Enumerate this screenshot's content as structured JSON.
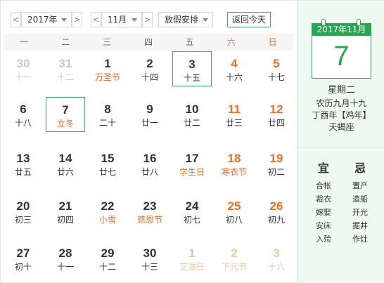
{
  "toolbar": {
    "prev_year": "<",
    "next_year": ">",
    "year": "2017年",
    "prev_month": "<",
    "next_month": ">",
    "month": "11月",
    "holiday": "放假安排",
    "today": "返回今天"
  },
  "weekdays": [
    "一",
    "二",
    "三",
    "四",
    "五",
    "六",
    "日"
  ],
  "rows": [
    [
      {
        "d": "30",
        "l": "十一",
        "other": true
      },
      {
        "d": "31",
        "l": "十二",
        "other": true
      },
      {
        "d": "1",
        "l": "万圣节",
        "fest": true
      },
      {
        "d": "2",
        "l": "十四"
      },
      {
        "d": "3",
        "l": "十五",
        "today": true
      },
      {
        "d": "4",
        "l": "十六",
        "wk": true
      },
      {
        "d": "5",
        "l": "十七",
        "wk": true
      }
    ],
    [
      {
        "d": "6",
        "l": "十八"
      },
      {
        "d": "7",
        "l": "立冬",
        "selected": true
      },
      {
        "d": "8",
        "l": "二十"
      },
      {
        "d": "9",
        "l": "廿一"
      },
      {
        "d": "10",
        "l": "廿二"
      },
      {
        "d": "11",
        "l": "廿三",
        "wk": true
      },
      {
        "d": "12",
        "l": "廿四",
        "wk": true
      }
    ],
    [
      {
        "d": "13",
        "l": "廿五"
      },
      {
        "d": "14",
        "l": "廿六"
      },
      {
        "d": "15",
        "l": "廿七"
      },
      {
        "d": "16",
        "l": "廿八"
      },
      {
        "d": "17",
        "l": "学生日",
        "fest": true
      },
      {
        "d": "18",
        "l": "寒衣节",
        "wk": true,
        "fest": true
      },
      {
        "d": "19",
        "l": "初二",
        "wk": true
      }
    ],
    [
      {
        "d": "20",
        "l": "初三"
      },
      {
        "d": "21",
        "l": "初四"
      },
      {
        "d": "22",
        "l": "小雪",
        "fest": true
      },
      {
        "d": "23",
        "l": "感恩节",
        "fest": true
      },
      {
        "d": "24",
        "l": "初七"
      },
      {
        "d": "25",
        "l": "初八",
        "wk": true
      },
      {
        "d": "26",
        "l": "初九",
        "wk": true
      }
    ],
    [
      {
        "d": "27",
        "l": "初十"
      },
      {
        "d": "28",
        "l": "十一"
      },
      {
        "d": "29",
        "l": "十二"
      },
      {
        "d": "30",
        "l": "十三"
      },
      {
        "d": "1",
        "l": "艾滋日",
        "other": true,
        "fest": true
      },
      {
        "d": "2",
        "l": "下元节",
        "other": true,
        "wk": true,
        "fest": true
      },
      {
        "d": "3",
        "l": "十六",
        "other": true,
        "wk": true
      }
    ]
  ],
  "side": {
    "header": "2017年11月",
    "day": "7",
    "weekday": "星期二",
    "lunar_date": "农历九月十九",
    "ganzhi": "丁酉年【鸡年】",
    "zodiac": "天蝎座",
    "yi_title": "宜",
    "ji_title": "忌",
    "yi": [
      "合帐",
      "裁衣",
      "嫁娶",
      "安床",
      "入殓"
    ],
    "ji": [
      "置产",
      "造船",
      "开光",
      "掘井",
      "作灶"
    ]
  },
  "colors": {
    "accent": "#2aa552",
    "weekend": "#f36c22",
    "other_month": "#c8c8c8",
    "side_bg": "#eefaf1"
  }
}
